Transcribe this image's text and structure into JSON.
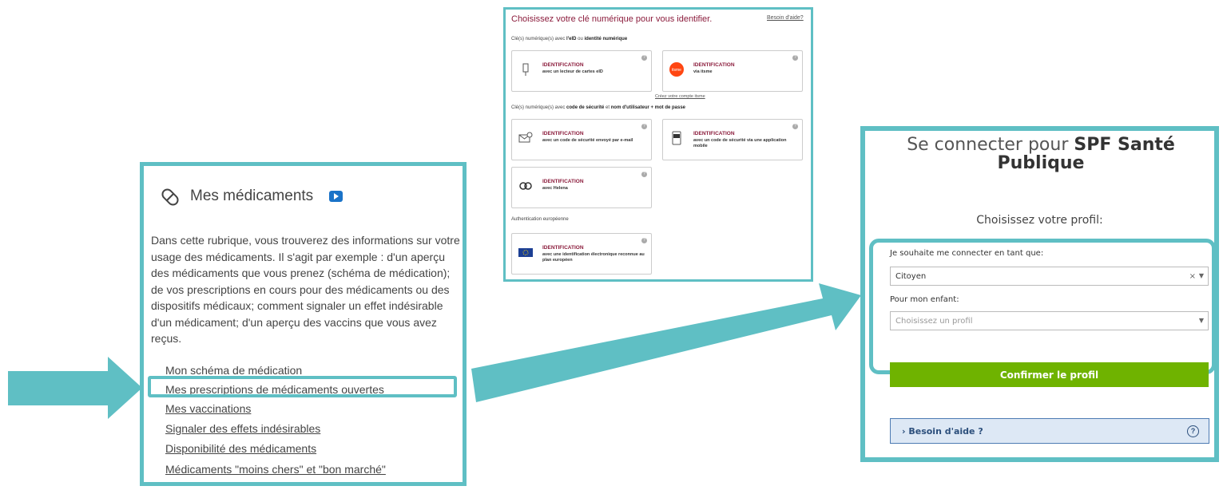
{
  "medicaments": {
    "title": "Mes médicaments",
    "description": "Dans cette rubrique, vous trouverez des informations sur votre usage des médicaments. Il s'agit par exemple : d'un aperçu des médicaments que vous prenez (schéma de médication); de vos prescriptions en cours pour des médicaments ou des dispositifs médicaux; comment signaler un effet indésirable d'un médicament; d'un aperçu des vaccins que vous avez reçus.",
    "links": [
      "Mon schéma de médication",
      "Mes prescriptions de médicaments ouvertes",
      "Mes vaccinations",
      "Signaler des effets indésirables",
      "Disponibilité des médicaments",
      "Médicaments \"moins chers\" et \"bon marché\""
    ],
    "highlighted_link_index": 1
  },
  "identification": {
    "title": "Choisissez votre clé numérique pour vous identifier.",
    "help_link": "Besoin d'aide?",
    "section1_prefix": "Clé(s) numérique(s) avec ",
    "section1_bold1": "l'eID",
    "section1_mid": " ou ",
    "section1_bold2": "identité numérique",
    "section2_prefix": "Clé(s) numérique(s) avec ",
    "section2_bold1": "code de sécurité",
    "section2_mid": " et ",
    "section2_bold2": "nom d'utilisateur + mot de passe",
    "section3": "Authentication européenne",
    "card_title": "IDENTIFICATION",
    "cards": {
      "eid": "avec un lecteur de cartes eID",
      "itsme": "via itsme",
      "itsme_link": "Créez votre compte itsme",
      "email": "avec un code de sécurité envoyé par e-mail",
      "mobile": "avec un code de sécurité via une application mobile",
      "helena": "avec Helena",
      "europe": "avec une identification électronique reconnue au plan européen"
    },
    "help_glyph": "?"
  },
  "spf": {
    "title_prefix": "Se connecter pour ",
    "title_bold": "SPF Santé Publique",
    "profile_label": "Choisissez votre profil:",
    "connect_as_label": "Je souhaite me connecter en tant que:",
    "connect_as_value": "Citoyen",
    "clear_glyph": "×",
    "arrow_glyph": "▼",
    "child_label": "Pour mon enfant:",
    "child_placeholder": "Choisissez un profil",
    "confirm_button": "Confirmer le profil",
    "help_button": "› Besoin d'aide ?",
    "help_icon": "?"
  },
  "colors": {
    "highlight": "#5fbfc4",
    "brand_red": "#8b1c3c",
    "confirm_green": "#6fb300"
  }
}
